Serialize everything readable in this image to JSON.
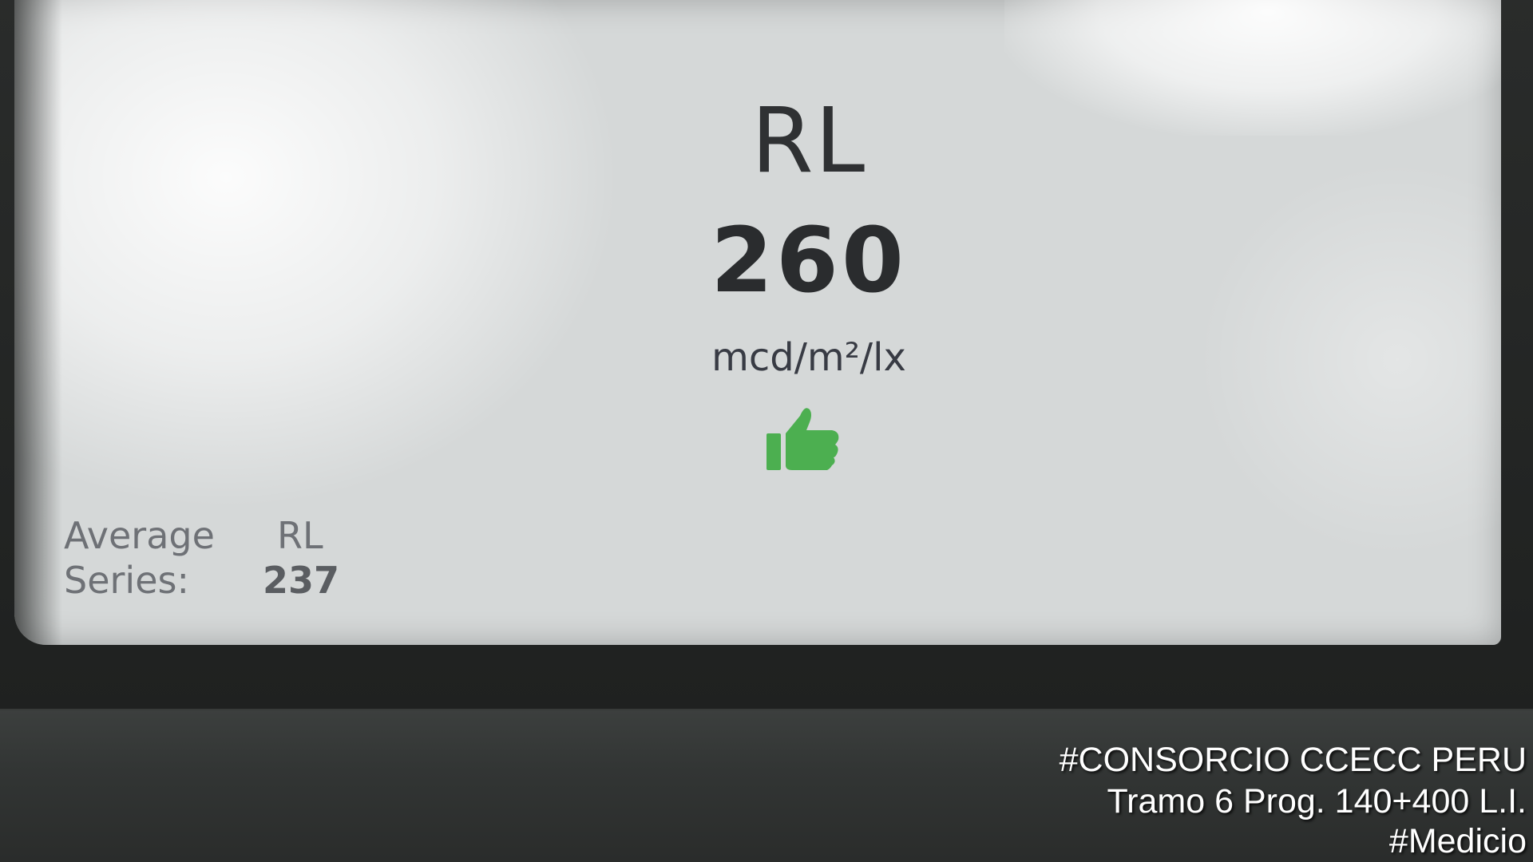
{
  "screen": {
    "title": "RL",
    "value": "260",
    "unit": "mcd/m²/lx",
    "status_icon": "thumbs-up-icon",
    "status_color": "#4caf50",
    "average": {
      "label_line1": "Average",
      "label_line2": "Series:",
      "metric": "RL",
      "value": "237"
    }
  },
  "watermark": {
    "line1": "#CONSORCIO CCECC PERU",
    "line2": "Tramo 6 Prog. 140+400 L.I.",
    "line3": "#Medicio"
  }
}
